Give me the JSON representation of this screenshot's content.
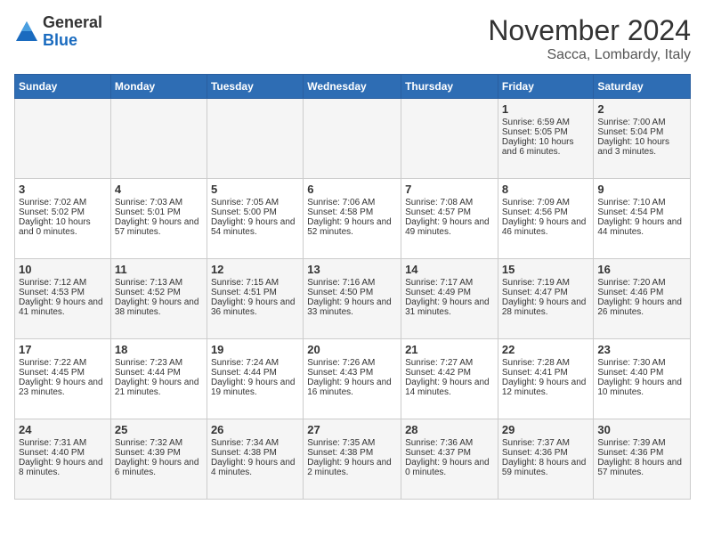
{
  "header": {
    "logo_general": "General",
    "logo_blue": "Blue",
    "month_title": "November 2024",
    "location": "Sacca, Lombardy, Italy"
  },
  "weekdays": [
    "Sunday",
    "Monday",
    "Tuesday",
    "Wednesday",
    "Thursday",
    "Friday",
    "Saturday"
  ],
  "weeks": [
    [
      {
        "day": "",
        "info": ""
      },
      {
        "day": "",
        "info": ""
      },
      {
        "day": "",
        "info": ""
      },
      {
        "day": "",
        "info": ""
      },
      {
        "day": "",
        "info": ""
      },
      {
        "day": "1",
        "info": "Sunrise: 6:59 AM\nSunset: 5:05 PM\nDaylight: 10 hours and 6 minutes."
      },
      {
        "day": "2",
        "info": "Sunrise: 7:00 AM\nSunset: 5:04 PM\nDaylight: 10 hours and 3 minutes."
      }
    ],
    [
      {
        "day": "3",
        "info": "Sunrise: 7:02 AM\nSunset: 5:02 PM\nDaylight: 10 hours and 0 minutes."
      },
      {
        "day": "4",
        "info": "Sunrise: 7:03 AM\nSunset: 5:01 PM\nDaylight: 9 hours and 57 minutes."
      },
      {
        "day": "5",
        "info": "Sunrise: 7:05 AM\nSunset: 5:00 PM\nDaylight: 9 hours and 54 minutes."
      },
      {
        "day": "6",
        "info": "Sunrise: 7:06 AM\nSunset: 4:58 PM\nDaylight: 9 hours and 52 minutes."
      },
      {
        "day": "7",
        "info": "Sunrise: 7:08 AM\nSunset: 4:57 PM\nDaylight: 9 hours and 49 minutes."
      },
      {
        "day": "8",
        "info": "Sunrise: 7:09 AM\nSunset: 4:56 PM\nDaylight: 9 hours and 46 minutes."
      },
      {
        "day": "9",
        "info": "Sunrise: 7:10 AM\nSunset: 4:54 PM\nDaylight: 9 hours and 44 minutes."
      }
    ],
    [
      {
        "day": "10",
        "info": "Sunrise: 7:12 AM\nSunset: 4:53 PM\nDaylight: 9 hours and 41 minutes."
      },
      {
        "day": "11",
        "info": "Sunrise: 7:13 AM\nSunset: 4:52 PM\nDaylight: 9 hours and 38 minutes."
      },
      {
        "day": "12",
        "info": "Sunrise: 7:15 AM\nSunset: 4:51 PM\nDaylight: 9 hours and 36 minutes."
      },
      {
        "day": "13",
        "info": "Sunrise: 7:16 AM\nSunset: 4:50 PM\nDaylight: 9 hours and 33 minutes."
      },
      {
        "day": "14",
        "info": "Sunrise: 7:17 AM\nSunset: 4:49 PM\nDaylight: 9 hours and 31 minutes."
      },
      {
        "day": "15",
        "info": "Sunrise: 7:19 AM\nSunset: 4:47 PM\nDaylight: 9 hours and 28 minutes."
      },
      {
        "day": "16",
        "info": "Sunrise: 7:20 AM\nSunset: 4:46 PM\nDaylight: 9 hours and 26 minutes."
      }
    ],
    [
      {
        "day": "17",
        "info": "Sunrise: 7:22 AM\nSunset: 4:45 PM\nDaylight: 9 hours and 23 minutes."
      },
      {
        "day": "18",
        "info": "Sunrise: 7:23 AM\nSunset: 4:44 PM\nDaylight: 9 hours and 21 minutes."
      },
      {
        "day": "19",
        "info": "Sunrise: 7:24 AM\nSunset: 4:44 PM\nDaylight: 9 hours and 19 minutes."
      },
      {
        "day": "20",
        "info": "Sunrise: 7:26 AM\nSunset: 4:43 PM\nDaylight: 9 hours and 16 minutes."
      },
      {
        "day": "21",
        "info": "Sunrise: 7:27 AM\nSunset: 4:42 PM\nDaylight: 9 hours and 14 minutes."
      },
      {
        "day": "22",
        "info": "Sunrise: 7:28 AM\nSunset: 4:41 PM\nDaylight: 9 hours and 12 minutes."
      },
      {
        "day": "23",
        "info": "Sunrise: 7:30 AM\nSunset: 4:40 PM\nDaylight: 9 hours and 10 minutes."
      }
    ],
    [
      {
        "day": "24",
        "info": "Sunrise: 7:31 AM\nSunset: 4:40 PM\nDaylight: 9 hours and 8 minutes."
      },
      {
        "day": "25",
        "info": "Sunrise: 7:32 AM\nSunset: 4:39 PM\nDaylight: 9 hours and 6 minutes."
      },
      {
        "day": "26",
        "info": "Sunrise: 7:34 AM\nSunset: 4:38 PM\nDaylight: 9 hours and 4 minutes."
      },
      {
        "day": "27",
        "info": "Sunrise: 7:35 AM\nSunset: 4:38 PM\nDaylight: 9 hours and 2 minutes."
      },
      {
        "day": "28",
        "info": "Sunrise: 7:36 AM\nSunset: 4:37 PM\nDaylight: 9 hours and 0 minutes."
      },
      {
        "day": "29",
        "info": "Sunrise: 7:37 AM\nSunset: 4:36 PM\nDaylight: 8 hours and 59 minutes."
      },
      {
        "day": "30",
        "info": "Sunrise: 7:39 AM\nSunset: 4:36 PM\nDaylight: 8 hours and 57 minutes."
      }
    ]
  ]
}
